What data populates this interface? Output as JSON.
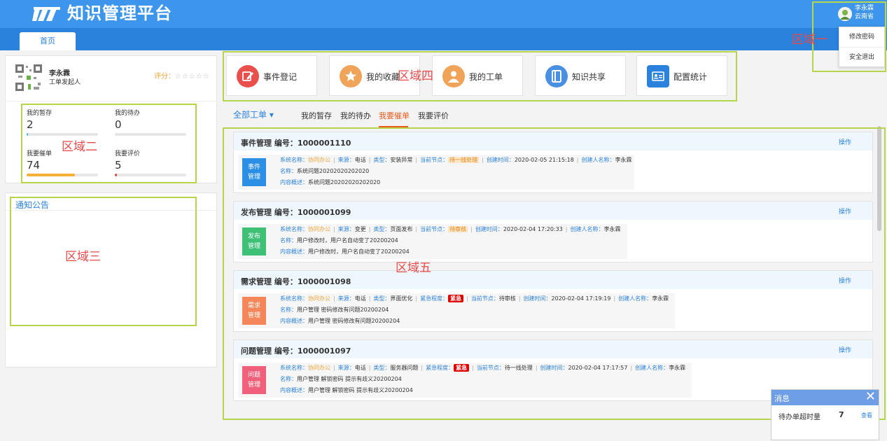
{
  "header": {
    "title": "知识管理平台",
    "user_name": "李永霖",
    "user_org": "云南省",
    "home_tab": "首页"
  },
  "user_menu": [
    "修改密码",
    "安全退出"
  ],
  "region_labels": [
    "区域一",
    "区域二",
    "区域三",
    "区域四",
    "区域五"
  ],
  "profile": {
    "name": "李永霖",
    "role": "工单发起人",
    "score_label": "评分：",
    "stars": "☆☆☆☆☆"
  },
  "stats": [
    {
      "label": "我的暂存",
      "value": "2",
      "progress": 0.02,
      "color": "#3db4d2"
    },
    {
      "label": "我的待办",
      "value": "0",
      "progress": 0.0,
      "color": "#3db4d2"
    },
    {
      "label": "我要催单",
      "value": "74",
      "progress": 0.68,
      "color": "#f3b035"
    },
    {
      "label": "我要评价",
      "value": "5",
      "progress": 0.03,
      "color": "#e0484a"
    }
  ],
  "notice": {
    "title": "通知公告"
  },
  "quick_actions": [
    {
      "label": "事件登记",
      "icon": "edit-icon",
      "color": "#e9504d"
    },
    {
      "label": "我的收藏",
      "icon": "star-icon",
      "color": "#f0a45a"
    },
    {
      "label": "我的工单",
      "icon": "user-icon",
      "color": "#f0a45a"
    },
    {
      "label": "知识共享",
      "icon": "book-icon",
      "color": "#4a90e2"
    },
    {
      "label": "配置统计",
      "icon": "id-card-icon",
      "color": "#2b82dd"
    }
  ],
  "filters": {
    "all": "全部工单 ▾",
    "tabs": [
      "我的暂存",
      "我的待办",
      "我要催单",
      "我要评价"
    ],
    "active": "我要催单"
  },
  "field_labels": {
    "system": "系统名称：",
    "source": "来源：",
    "type": "类型：",
    "urgency": "紧急程度：",
    "node": "当前节点：",
    "created": "创建时间：",
    "creator": "创建人名称：",
    "name": "名称：",
    "summary": "内容概述：",
    "operation": "操作"
  },
  "tickets": [
    {
      "category": "事件管理",
      "number_label": "编号：1000001110",
      "tag": "事件\n管理",
      "tag_color": "#2b8fe6",
      "system": "协同办公",
      "source": "电话",
      "type": "安装异常",
      "urgency": "",
      "node": "待一线处理",
      "node_highlight": true,
      "created": "2020-02-05 21:15:18",
      "creator": "李永霖",
      "name": "系统问题20202020202020",
      "summary": "系统问题20202020202020"
    },
    {
      "category": "发布管理",
      "number_label": "编号：1000001099",
      "tag": "发布\n管理",
      "tag_color": "#3ec177",
      "system": "协同办公",
      "source": "变更",
      "type": "页面发布",
      "urgency": "",
      "node": "待审核",
      "node_highlight": true,
      "created": "2020-02-04 17:20:33",
      "creator": "李永霖",
      "name": "用户修改时，用户名自动变了20200204",
      "summary": "用户修改时，用户名自动变了20200204"
    },
    {
      "category": "需求管理",
      "number_label": "编号：1000001098",
      "tag": "需求\n管理",
      "tag_color": "#f3875a",
      "system": "协同办公",
      "source": "电话",
      "type": "界面优化",
      "urgency": "紧急",
      "node": "待审核",
      "node_highlight": false,
      "created": "2020-02-04 17:19:19",
      "creator": "李永霖",
      "name": "用户管理 密码修改有问题20200204",
      "summary": "用户管理 密码修改有问题20200204"
    },
    {
      "category": "问题管理",
      "number_label": "编号：1000001097",
      "tag": "问题\n管理",
      "tag_color": "#f0607a",
      "system": "协同办公",
      "source": "电话",
      "type": "服务器问题",
      "urgency": "紧急",
      "node": "待一线处理",
      "node_highlight": false,
      "created": "2020-02-04 17:17:57",
      "creator": "李永霖",
      "name": "用户管理 解锁密码 提示有歧义20200204",
      "summary": "用户管理 解锁密码 提示有歧义20200204"
    }
  ],
  "message": {
    "title": "消息",
    "text": "待办单超时量",
    "count": "7",
    "link": "查看"
  }
}
